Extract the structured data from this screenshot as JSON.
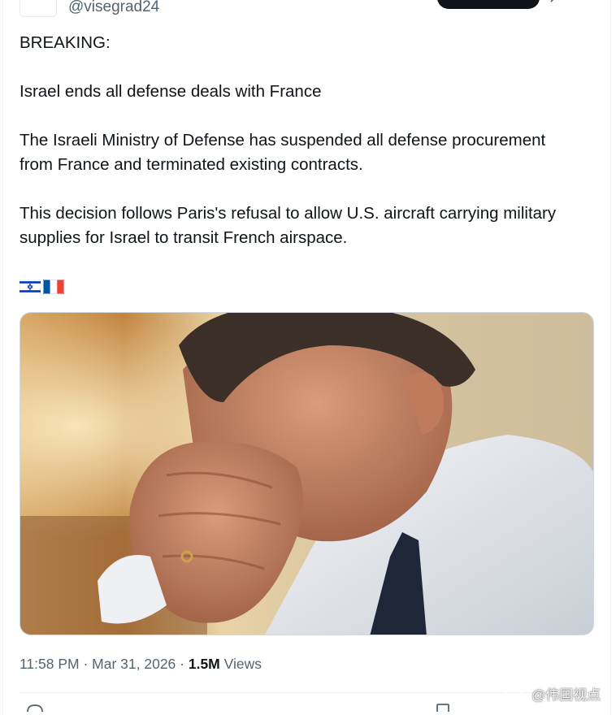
{
  "author": {
    "handle": "@visegrad24"
  },
  "tweet": {
    "lines": [
      "BREAKING:",
      "Israel ends all defense deals with France",
      "The Israeli Ministry of Defense has suspended all defense procurement",
      "from France and terminated existing contracts.",
      "This decision follows Paris's refusal to allow U.S. aircraft carrying military",
      "supplies for Israel to transit French airspace."
    ],
    "flags": [
      "israel-flag-emoji",
      "france-flag-emoji"
    ]
  },
  "meta": {
    "time": "11:58 PM",
    "sep1": " · ",
    "date": "Mar 31, 2026",
    "sep2": " · ",
    "views_count": "1.5M",
    "views_label": " Views"
  },
  "watermark": {
    "text": "@伟国视点",
    "icon": "weibo-icon"
  },
  "colors": {
    "text": "#0f1419",
    "secondary": "#536471",
    "border": "#eff3f4",
    "israel_blue": "#0038b8",
    "france_blue": "#0055a4",
    "france_red": "#ef4135"
  }
}
